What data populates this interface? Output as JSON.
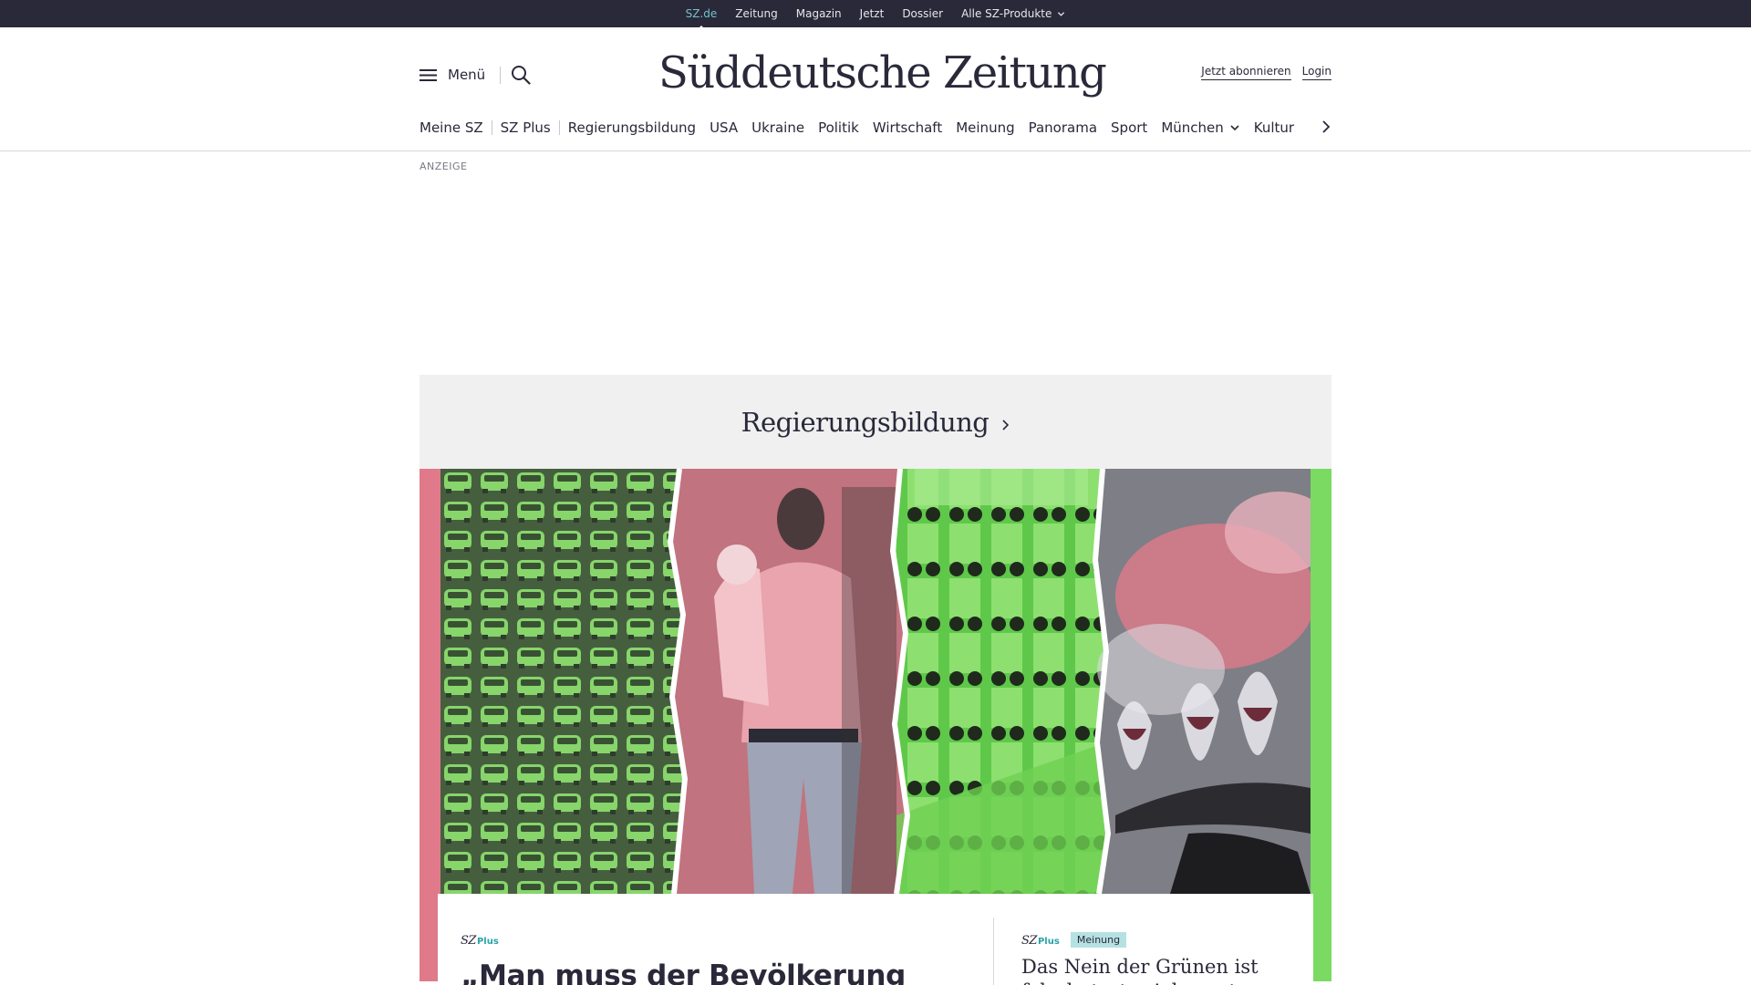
{
  "topbar": {
    "items": [
      {
        "label": "SZ.de",
        "active": true
      },
      {
        "label": "Zeitung"
      },
      {
        "label": "Magazin"
      },
      {
        "label": "Jetzt"
      },
      {
        "label": "Dossier"
      },
      {
        "label": "Alle SZ-Produkte",
        "dropdown": true
      }
    ]
  },
  "header": {
    "menu_label": "Menü",
    "menu_icon": "hamburger-icon",
    "search_icon": "search-icon",
    "logo_text": "Süddeutsche Zeitung",
    "subscribe_label": "Jetzt abonnieren",
    "login_label": "Login"
  },
  "nav": {
    "items": [
      {
        "label": "Meine SZ"
      },
      {
        "label": "SZ Plus"
      },
      {
        "label": "Regierungsbildung"
      },
      {
        "label": "USA"
      },
      {
        "label": "Ukraine"
      },
      {
        "label": "Politik"
      },
      {
        "label": "Wirtschaft"
      },
      {
        "label": "Meinung"
      },
      {
        "label": "Panorama"
      },
      {
        "label": "Sport"
      },
      {
        "label": "München",
        "dropdown": true
      },
      {
        "label": "Kultur"
      }
    ],
    "next_icon": "chevron-right-icon"
  },
  "ad": {
    "label": "ANZEIGE"
  },
  "section": {
    "title": "Regierungsbildung",
    "icon": "chevron-right-icon"
  },
  "teaser": {
    "frame_colors": {
      "left": "#e07a8a",
      "right": "#7ada62"
    },
    "main": {
      "brand_sz": "SZ",
      "brand_plus": "Plus",
      "headline": "„Man muss der Bevölkerung reinen Wein einschenken“"
    },
    "side": {
      "brand_sz": "SZ",
      "brand_plus": "Plus",
      "badge": "Meinung",
      "headline": "Das Nein der Grünen ist falsch, trotz vieler guter"
    }
  },
  "colors": {
    "ink": "#29293a",
    "accent_teal": "#71c3c8",
    "green": "#7ada62",
    "pink": "#e07a8a"
  }
}
